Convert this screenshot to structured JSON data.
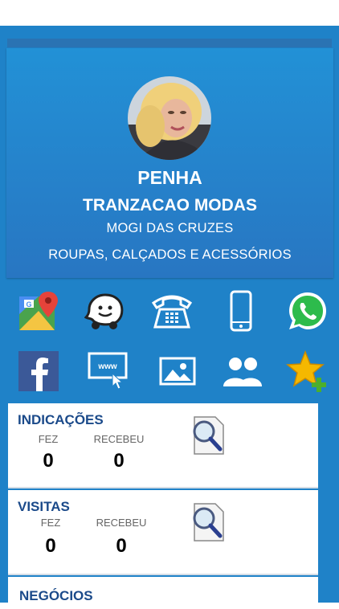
{
  "profile": {
    "name": "PENHA",
    "company": "TRANZACAO MODAS",
    "city": "MOGI DAS CRUZES",
    "category": "ROUPAS, CALÇADOS E ACESSÓRIOS"
  },
  "actions_row1": [
    {
      "icon": "google-maps-icon"
    },
    {
      "icon": "waze-icon"
    },
    {
      "icon": "telephone-icon"
    },
    {
      "icon": "mobile-phone-icon"
    },
    {
      "icon": "whatsapp-icon"
    }
  ],
  "actions_row2": [
    {
      "icon": "facebook-icon"
    },
    {
      "icon": "website-icon"
    },
    {
      "icon": "gallery-icon"
    },
    {
      "icon": "contacts-icon"
    },
    {
      "icon": "add-favorite-icon"
    }
  ],
  "cards": {
    "indicacoes": {
      "title": "INDICAÇÕES",
      "fez_label": "FEZ",
      "recebeu_label": "RECEBEU",
      "fez": "0",
      "recebeu": "0"
    },
    "visitas": {
      "title": "VISITAS",
      "fez_label": "FEZ",
      "recebeu_label": "RECEBEU",
      "fez": "0",
      "recebeu": "0"
    },
    "negocios": {
      "title": "NEGÓCIOS"
    }
  },
  "colors": {
    "background": "#1f82c8",
    "hero_top": "#2291d6",
    "hero_bottom": "#2876c2",
    "card_title": "#1b4a8a"
  }
}
